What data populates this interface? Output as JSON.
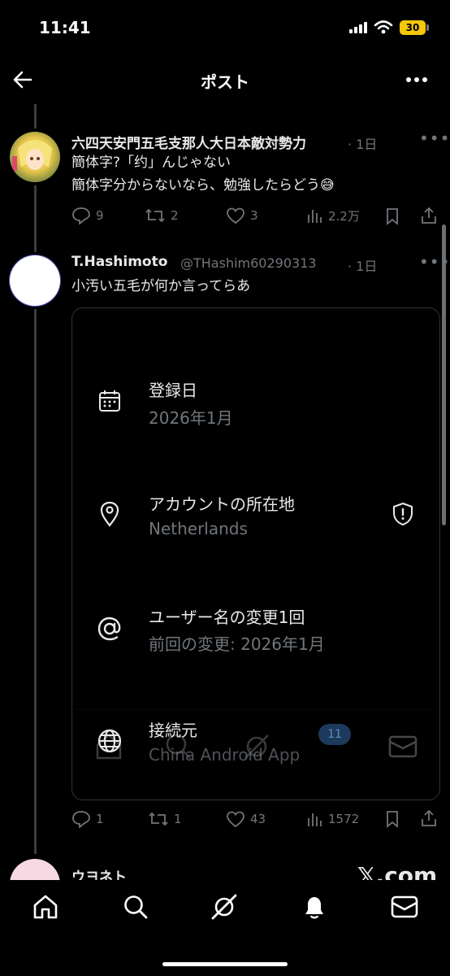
{
  "status_bar": {
    "time": "11:41",
    "battery": "30"
  },
  "header": {
    "title": "ポスト"
  },
  "posts": [
    {
      "name": "六四天安門五毛支那人大日本敵対勢力",
      "time": "· 1日",
      "lines": [
        "簡体字?「约」んじゃない",
        "簡体字分からないなら、勉強したらどう😅"
      ],
      "replies": "9",
      "reposts": "2",
      "likes": "3",
      "views": "2.2万"
    },
    {
      "name": "T.Hashimoto",
      "handle": "@THashim60290313",
      "time": "· 1日",
      "lines": [
        "小汚い五毛が何か言ってらあ"
      ],
      "replies": "1",
      "reposts": "1",
      "likes": "43",
      "views": "1572"
    }
  ],
  "profile_card": {
    "rows": [
      {
        "icon": "calendar-icon",
        "title": "登録日",
        "value": "2026年1月"
      },
      {
        "icon": "location-pin-icon",
        "title": "アカウントの所在地",
        "value": "Netherlands"
      },
      {
        "icon": "at-sign-icon",
        "title": "ユーザー名の変更1回",
        "value": "前回の変更: 2026年1月"
      },
      {
        "icon": "globe-icon",
        "title": "接続元",
        "value": "China Android App"
      }
    ],
    "ghost_badge": "11"
  },
  "next_post": {
    "name": "ウヨネト",
    "overlay": "𝕏.com"
  },
  "tab_bar": {
    "items": [
      "home",
      "search",
      "grok",
      "notifications",
      "messages"
    ]
  }
}
